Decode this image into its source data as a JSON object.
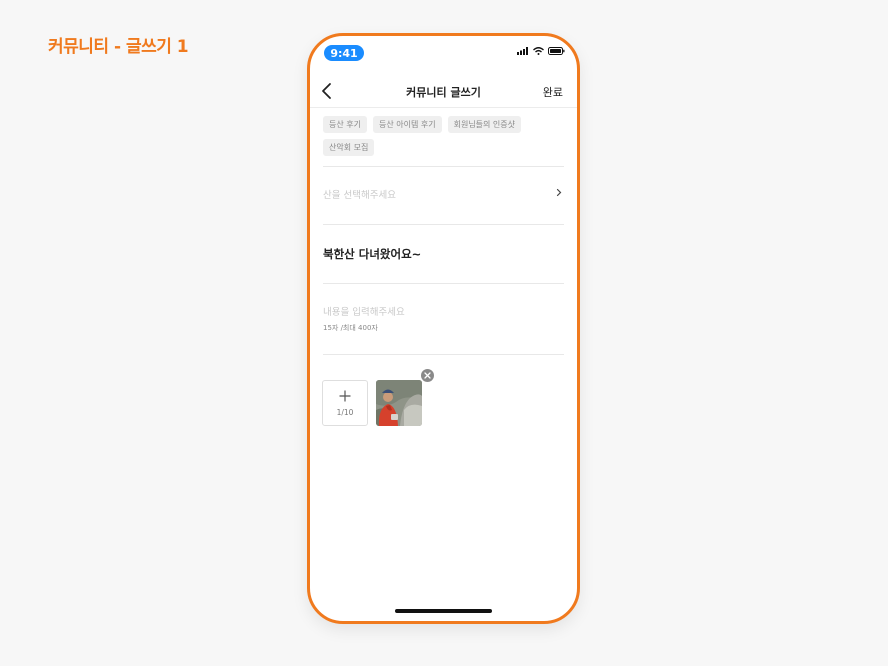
{
  "page": {
    "label": "커뮤니티 - 글쓰기 1"
  },
  "status_bar": {
    "time": "9:41"
  },
  "nav": {
    "title": "커뮤니티 글쓰기",
    "done_label": "완료"
  },
  "chips": [
    {
      "label": "등산 후기"
    },
    {
      "label": "등산 아이템 후기"
    },
    {
      "label": "회원님들의 인증샷"
    },
    {
      "label": "산악회 모집"
    }
  ],
  "mountain": {
    "placeholder": "산을 선택해주세요"
  },
  "post": {
    "title": "북한산 다녀왔어요~",
    "content_placeholder": "내용을 입력해주세요",
    "char_count": "15자 /최대 400자"
  },
  "photos": {
    "count": "1/10"
  },
  "colors": {
    "accent": "#f07a1e",
    "time_pill": "#1a8cff"
  }
}
